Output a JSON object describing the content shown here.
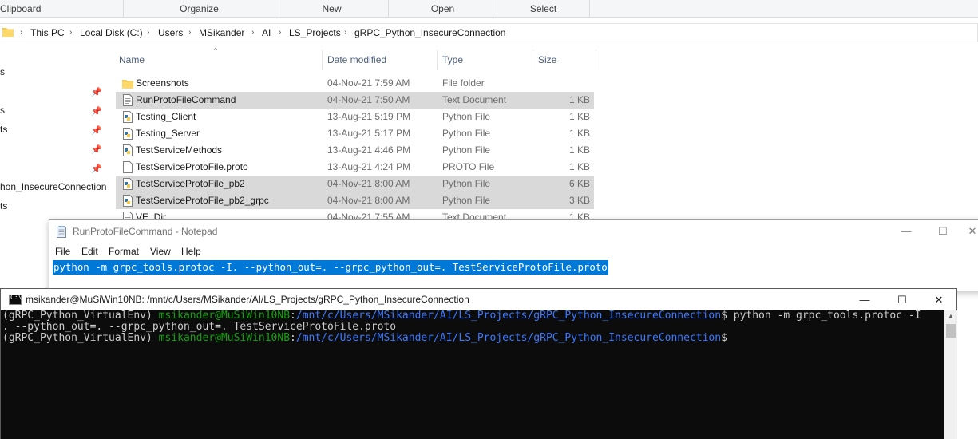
{
  "ribbon": {
    "groups": [
      "Clipboard",
      "Organize",
      "New",
      "Open",
      "Select"
    ]
  },
  "address": {
    "crumbs": [
      "This PC",
      "Local Disk (C:)",
      "Users",
      "MSikander",
      "AI",
      "LS_Projects",
      "gRPC_Python_InsecureConnection"
    ]
  },
  "nav_pane": {
    "items": [
      "s",
      "s",
      "ts",
      "hon_InsecureConnection",
      "ts"
    ]
  },
  "columns": {
    "name": "Name",
    "date": "Date modified",
    "type": "Type",
    "size": "Size"
  },
  "files": [
    {
      "name": "Screenshots",
      "date": "04-Nov-21 7:59 AM",
      "type": "File folder",
      "size": "",
      "icon": "folder-icon"
    },
    {
      "name": "RunProtoFileCommand",
      "date": "04-Nov-21 7:50 AM",
      "type": "Text Document",
      "size": "1 KB",
      "icon": "text-file-icon"
    },
    {
      "name": "Testing_Client",
      "date": "13-Aug-21 5:19 PM",
      "type": "Python File",
      "size": "1 KB",
      "icon": "python-file-icon"
    },
    {
      "name": "Testing_Server",
      "date": "13-Aug-21 5:17 PM",
      "type": "Python File",
      "size": "1 KB",
      "icon": "python-file-icon"
    },
    {
      "name": "TestServiceMethods",
      "date": "13-Aug-21 4:46 PM",
      "type": "Python File",
      "size": "1 KB",
      "icon": "python-file-icon"
    },
    {
      "name": "TestServiceProtoFile.proto",
      "date": "13-Aug-21 4:24 PM",
      "type": "PROTO File",
      "size": "1 KB",
      "icon": "blank-file-icon"
    },
    {
      "name": "TestServiceProtoFile_pb2",
      "date": "04-Nov-21 8:00 AM",
      "type": "Python File",
      "size": "6 KB",
      "icon": "python-file-icon"
    },
    {
      "name": "TestServiceProtoFile_pb2_grpc",
      "date": "04-Nov-21 8:00 AM",
      "type": "Python File",
      "size": "3 KB",
      "icon": "python-file-icon"
    },
    {
      "name": "VE_Dir",
      "date": "04-Nov-21 7:55 AM",
      "type": "Text Document",
      "size": "1 KB",
      "icon": "text-file-icon"
    }
  ],
  "notepad": {
    "title": "RunProtoFileCommand - Notepad",
    "menu": [
      "File",
      "Edit",
      "Format",
      "View",
      "Help"
    ],
    "content": "python -m grpc_tools.protoc -I. --python_out=. --grpc_python_out=. TestServiceProtoFile.proto",
    "controls": {
      "minimize": "—",
      "maximize": "☐",
      "close": "✕"
    }
  },
  "terminal": {
    "title": "msikander@MuSiWin10NB: /mnt/c/Users/MSikander/AI/LS_Projects/gRPC_Python_InsecureConnection",
    "controls": {
      "minimize": "—",
      "maximize": "☐",
      "close": "✕"
    },
    "lines": [
      {
        "env": "(gRPC_Python_VirtualEnv) ",
        "user": "msikander@MuSiWin10NB",
        "sep": ":",
        "path": "/mnt/c/Users/MSikander/AI/LS_Projects/gRPC_Python_InsecureConnection",
        "cmd": "$ python -m grpc_tools.protoc -I"
      },
      {
        "text": ". --python_out=. --grpc_python_out=. TestServiceProtoFile.proto"
      },
      {
        "env": "(gRPC_Python_VirtualEnv) ",
        "user": "msikander@MuSiWin10NB",
        "sep": ":",
        "path": "/mnt/c/Users/MSikander/AI/LS_Projects/gRPC_Python_InsecureConnection",
        "cmd": "$"
      }
    ],
    "scroll_up_glyph": "▲"
  }
}
